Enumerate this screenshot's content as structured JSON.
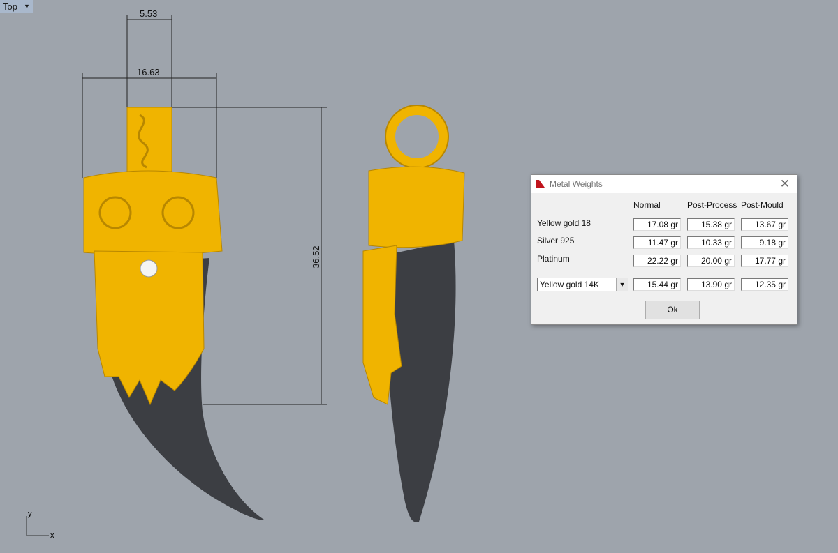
{
  "viewport": {
    "name": "Top"
  },
  "dimensions": {
    "top_width": "5.53",
    "body_width": "16.63",
    "height": "36.52"
  },
  "axes": {
    "y": "y",
    "x": "x"
  },
  "dialog": {
    "title": "Metal Weights",
    "columns": [
      "Normal",
      "Post-Process",
      "Post-Mould"
    ],
    "rows": [
      {
        "label": "Yellow gold 18",
        "values": [
          "17.08 gr",
          "15.38 gr",
          "13.67 gr"
        ]
      },
      {
        "label": "Silver 925",
        "values": [
          "11.47 gr",
          "10.33 gr",
          "9.18 gr"
        ]
      },
      {
        "label": "Platinum",
        "values": [
          "22.22 gr",
          "20.00 gr",
          "17.77 gr"
        ]
      }
    ],
    "custom": {
      "selected": "Yellow gold 14K",
      "values": [
        "15.44 gr",
        "13.90 gr",
        "12.35 gr"
      ]
    },
    "ok_label": "Ok",
    "colors": {
      "gold": "#f0b400",
      "horn": "#3c3e43"
    }
  }
}
